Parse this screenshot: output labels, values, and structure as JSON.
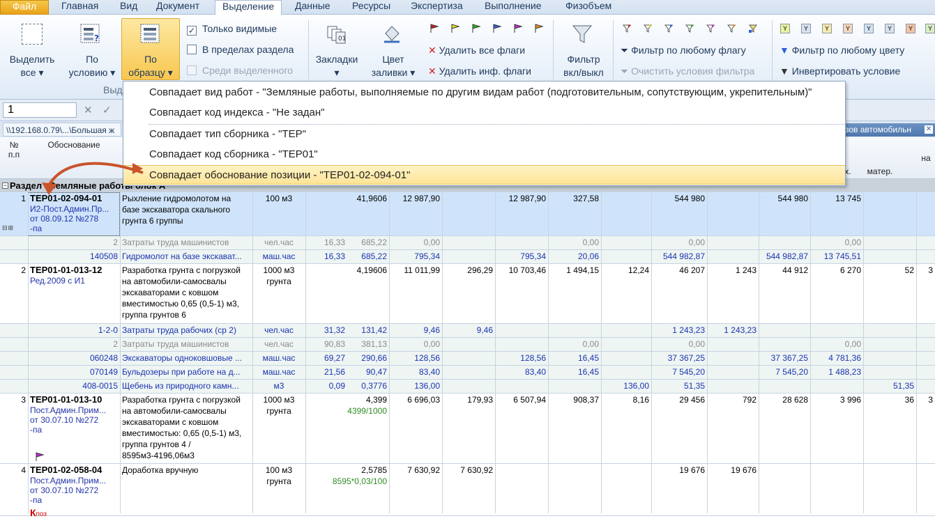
{
  "menu": {
    "file": "Файл",
    "items": [
      "Главная",
      "Вид",
      "Документ",
      "Выделение",
      "Данные",
      "Ресурсы",
      "Экспертиза",
      "Выполнение",
      "Физобъем"
    ]
  },
  "ribbon": {
    "select_all_1": "Выделить",
    "select_all_2": "все",
    "by_condition_1": "По",
    "by_condition_2": "условию",
    "by_sample_1": "По",
    "by_sample_2": "образцу",
    "only_visible": "Только видимые",
    "within_section": "В пределах раздела",
    "among_selected": "Среди выделенного",
    "group_label": "Выд",
    "bookmarks": "Закладки",
    "fill_color_1": "Цвет",
    "fill_color_2": "заливки",
    "remove_all_flags": "Удалить все флаги",
    "remove_info_flags": "Удалить инф. флаги",
    "filter_toggle_1": "Фильтр",
    "filter_toggle_2": "вкл/выкл",
    "filter_any_flag": "Фильтр по любому флагу",
    "clear_filter": "Очистить условия фильтра",
    "filter_any_color": "Фильтр по любому цвету",
    "invert_condition": "Инвертировать условие",
    "flag_colors": [
      "#d21f1f",
      "#e8e01c",
      "#26b81f",
      "#2f5fe0",
      "#c32bd6",
      "#f08a1c"
    ],
    "color_swatches": [
      "#e8f3a0",
      "#d8e2ee",
      "#f7ecb0",
      "#f5d8c0",
      "#d3e3f2",
      "#d8e2ee",
      "#f3c3a5",
      "#d9efc5"
    ]
  },
  "formula": {
    "cell_value": "1"
  },
  "path": {
    "left": "\\\\192.168.0.79\\...\\Большая ж",
    "right": "зов автомобильн"
  },
  "columns": {
    "num": "№\nп.п",
    "basis": "Обоснование",
    "mach": "х.",
    "mater": "матер.",
    "na": "на"
  },
  "dropdown": {
    "items": [
      "Совпадает вид работ - \"Земляные работы, выполняемые по другим видам работ (подготовительным, сопутствующим, укрепительным)\"",
      "Совпадает код индекса - \"Не задан\"",
      "Совпадает тип сборника - \"ТЕР\"",
      "Совпадает код сборника - \"ТЕР01\"",
      "Совпадает обоснование позиции - \"ТЕР01-02-094-01\""
    ]
  },
  "section": {
    "label": "Раздел - Земляные работы блок А"
  },
  "rows": [
    {
      "n": "1",
      "code": "ТЕР01-02-094-01",
      "sub": [
        "И2-Пост.Админ.Пр...",
        "от 08.09.12 №278",
        "-па"
      ],
      "name": [
        "Рыхление гидромолотом на",
        "базе экскаватора скального",
        "грунта 6 группы"
      ],
      "unit": [
        "100 м3"
      ],
      "qty": "41,9606",
      "v1": "12 987,90",
      "v2": "",
      "v3": "12 987,90",
      "v4": "327,58",
      "v5": "",
      "v6": "544 980",
      "v7": "",
      "v8": "544 980",
      "v9": "13 745",
      "v10": "",
      "v11": ""
    },
    {
      "n": "2",
      "basis": "",
      "name": "Затраты труда машинистов",
      "unit": "чел.час",
      "a": "16,33",
      "b": "685,22",
      "v1": "0,00",
      "v2": "",
      "v3": "",
      "v4": "0,00",
      "v5": "",
      "v6": "0,00",
      "v7": "",
      "v8": "",
      "v9": "0,00",
      "v10": "",
      "v11": "",
      "style": "grey"
    },
    {
      "n": "140508",
      "basis": "",
      "name": "Гидромолот на базе экскават...",
      "unit": "маш.час",
      "a": "16,33",
      "b": "685,22",
      "v1": "795,34",
      "v2": "",
      "v3": "795,34",
      "v4": "20,06",
      "v5": "",
      "v6": "544 982,87",
      "v7": "",
      "v8": "544 982,87",
      "v9": "13 745,51",
      "v10": "",
      "v11": "",
      "style": "blue"
    },
    {
      "n": "2",
      "code": "ТЕР01-01-013-12",
      "sub": [
        "Ред.2009 с И1"
      ],
      "name": [
        "Разработка грунта с погрузкой",
        "на автомобили-самосвалы",
        "экскаваторами с ковшом",
        "вместимостью 0,65 (0,5-1) м3,",
        "группа грунтов 6"
      ],
      "unit": [
        "1000 м3",
        "грунта"
      ],
      "qty": "4,19606",
      "v1": "11 011,99",
      "v2": "296,29",
      "v3": "10 703,46",
      "v4": "1 494,15",
      "v5": "12,24",
      "v6": "46 207",
      "v7": "1 243",
      "v8": "44 912",
      "v9": "6 270",
      "v10": "52",
      "v11": "3"
    },
    {
      "n": "1-2-0",
      "basis": "",
      "name": "Затраты труда рабочих (ср 2)",
      "unit": "чел.час",
      "a": "31,32",
      "b": "131,42",
      "v1": "9,46",
      "v2": "9,46",
      "v3": "",
      "v4": "",
      "v5": "",
      "v6": "1 243,23",
      "v7": "1 243,23",
      "v8": "",
      "v9": "",
      "v10": "",
      "v11": "",
      "style": "blue"
    },
    {
      "n": "2",
      "basis": "",
      "name": "Затраты труда машинистов",
      "unit": "чел.час",
      "a": "90,83",
      "b": "381,13",
      "v1": "0,00",
      "v2": "",
      "v3": "",
      "v4": "0,00",
      "v5": "",
      "v6": "0,00",
      "v7": "",
      "v8": "",
      "v9": "0,00",
      "v10": "",
      "v11": "",
      "style": "grey"
    },
    {
      "n": "060248",
      "basis": "",
      "name": "Экскаваторы одноковшовые ...",
      "unit": "маш.час",
      "a": "69,27",
      "b": "290,66",
      "v1": "128,56",
      "v2": "",
      "v3": "128,56",
      "v4": "16,45",
      "v5": "",
      "v6": "37 367,25",
      "v7": "",
      "v8": "37 367,25",
      "v9": "4 781,36",
      "v10": "",
      "v11": "",
      "style": "blue"
    },
    {
      "n": "070149",
      "basis": "",
      "name": "Бульдозеры при работе на д...",
      "unit": "маш.час",
      "a": "21,56",
      "b": "90,47",
      "v1": "83,40",
      "v2": "",
      "v3": "83,40",
      "v4": "16,45",
      "v5": "",
      "v6": "7 545,20",
      "v7": "",
      "v8": "7 545,20",
      "v9": "1 488,23",
      "v10": "",
      "v11": "",
      "style": "blue"
    },
    {
      "n": "408-0015",
      "basis": "",
      "name": "Щебень из природного камн...",
      "unit": "м3",
      "a": "0,09",
      "b": "0,3776",
      "v1": "136,00",
      "v2": "",
      "v3": "",
      "v4": "",
      "v5": "136,00",
      "v6": "51,35",
      "v7": "",
      "v8": "",
      "v9": "",
      "v10": "51,35",
      "v11": "",
      "style": "blue"
    },
    {
      "n": "3",
      "code": "ТЕР01-01-013-10",
      "sub": [
        "Пост.Админ.Прим...",
        "от 30.07.10 №272",
        "-па"
      ],
      "name": [
        "Разработка грунта с погрузкой",
        "на автомобили-самосвалы",
        "экскаваторами с ковшом",
        "вместимостью: 0,65 (0,5-1) м3,",
        "группа грунтов 4  /",
        "8595м3-4196,06м3"
      ],
      "unit": [
        "1000 м3",
        "грунта"
      ],
      "qty": "4,399",
      "formula": "4399/1000",
      "v1": "6 696,03",
      "v2": "179,93",
      "v3": "6 507,94",
      "v4": "908,37",
      "v5": "8,16",
      "v6": "29 456",
      "v7": "792",
      "v8": "28 628",
      "v9": "3 996",
      "v10": "36",
      "v11": "3"
    },
    {
      "n": "4",
      "code": "ТЕР01-02-058-04",
      "sub": [
        "Пост.Админ.Прим...",
        "от 30.07.10 №272",
        "-па"
      ],
      "name": [
        "Доработка вручную"
      ],
      "unit": [
        "100 м3",
        "грунта"
      ],
      "qty": "2,5785",
      "formula": "8595*0,03/100",
      "v1": "7 630,92",
      "v2": "7 630,92",
      "v3": "",
      "v4": "",
      "v5": "",
      "v6": "19 676",
      "v7": "19 676",
      "v8": "",
      "v9": "",
      "v10": "",
      "v11": "",
      "mark": "К",
      "mark2": "поз"
    }
  ]
}
